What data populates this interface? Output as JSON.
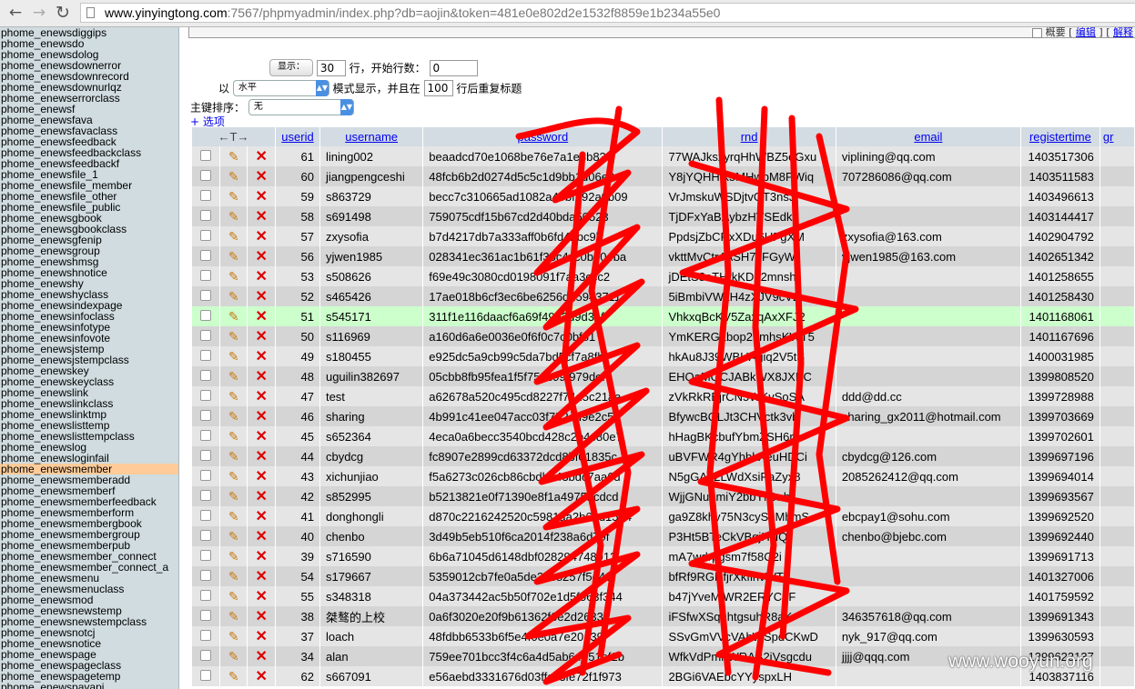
{
  "browser": {
    "url_host": "www.yinyingtong.com",
    "url_rest": ":7567/phpmyadmin/index.php?db=aojin&token=481e0e802d2e1532f8859e1b234a55e0",
    "back_icon": "arrow-left-icon",
    "forward_icon": "arrow-right-icon",
    "reload_icon": "reload-icon"
  },
  "sidebar": {
    "items": [
      "phome_enewsdiggips",
      "phome_enewsdo",
      "phome_enewsdolog",
      "phome_enewsdownerror",
      "phome_enewsdownrecord",
      "phome_enewsdownurlqz",
      "phome_enewserrorclass",
      "phome_enewsf",
      "phome_enewsfava",
      "phome_enewsfavaclass",
      "phome_enewsfeedback",
      "phome_enewsfeedbackclass",
      "phome_enewsfeedbackf",
      "phome_enewsfile_1",
      "phome_enewsfile_member",
      "phome_enewsfile_other",
      "phome_enewsfile_public",
      "phome_enewsgbook",
      "phome_enewsgbookclass",
      "phome_enewsgfenip",
      "phome_enewsgroup",
      "phome_enewshmsg",
      "phome_enewshnotice",
      "phome_enewshy",
      "phome_enewshyclass",
      "phome_enewsindexpage",
      "phome_enewsinfoclass",
      "phome_enewsinfotype",
      "phome_enewsinfovote",
      "phome_enewsjstemp",
      "phome_enewsjstempclass",
      "phome_enewskey",
      "phome_enewskeyclass",
      "phome_enewslink",
      "phome_enewslinkclass",
      "phome_enewslinktmp",
      "phome_enewslisttemp",
      "phome_enewslisttempclass",
      "phome_enewslog",
      "phome_enewsloginfail",
      "phome_enewsmember",
      "phome_enewsmemberadd",
      "phome_enewsmemberf",
      "phome_enewsmemberfeedback",
      "phome_enewsmemberform",
      "phome_enewsmembergbook",
      "phome_enewsmembergroup",
      "phome_enewsmemberpub",
      "phome_enewsmember_connect",
      "phome_enewsmember_connect_a",
      "phome_enewsmenu",
      "phome_enewsmenuclass",
      "phome_enewsmod",
      "phome_enewsnewstemp",
      "phome_enewsnewstempclass",
      "phome_enewsnotcj",
      "phome_enewsnotice",
      "phome_enewspage",
      "phome_enewspageclass",
      "phome_enewspagetemp",
      "phome_enewspayapi"
    ],
    "active_index": 40
  },
  "toplinks": {
    "summary_label": "概要",
    "edit_label": "编辑",
    "explain_label": "解释"
  },
  "controls": {
    "show_button": "显示：",
    "rows_value": "30",
    "rows_label": "行，开始行数：",
    "start_value": "0",
    "mode_prefix": "以",
    "mode_value": "水平",
    "mode_label": "模式显示，并且在",
    "repeat_value": "100",
    "repeat_label": "行后重复标题",
    "sort_label": "主键排序：",
    "sort_value": "无",
    "options_link": "+ 选项"
  },
  "table": {
    "columns": [
      "userid",
      "username",
      "password",
      "rnd",
      "email",
      "registertime",
      "gr"
    ],
    "rows": [
      [
        "61",
        "lining002",
        "beaadcd70e1068be76e7a1e3b83",
        "77WAJksxyrqHhWBZ5eGxu",
        "viplining@qq.com",
        "1403517306"
      ],
      [
        "60",
        "jiangpengceshi",
        "48fcb6b2d0274d5c5c1d9bb1d06e0",
        "Y8jYQHHfk5MHwbM8PWiq",
        "707286086@qq.com",
        "1403511583"
      ],
      [
        "59",
        "s863729",
        "becc7c310665ad1082a45bf192a0b09",
        "VrJmskuWSDjtvGT3nsJ",
        "",
        "1403496613"
      ],
      [
        "58",
        "s691498",
        "759075cdf15b67cd2d40bda50523",
        "TjDFxYaBAybzHVSEdk",
        "",
        "1403144417"
      ],
      [
        "57",
        "zxysofia",
        "b7d4217db7a333aff0b6fd42bc9b",
        "PpdsjZbCRxXDu6UFgXM",
        "zxysofia@163.com",
        "1402904792"
      ],
      [
        "56",
        "yjwen1985",
        "028341ec361ac1b61f35c4cc0b504ba",
        "vkttMvCtr4ASH7JFGyW",
        "yjwen1985@163.com",
        "1402651342"
      ],
      [
        "53",
        "s508626",
        "f69e49c3080cd0198091f7aa3ccc2",
        "jDEtS3eTHrkKDL2mnsh",
        "",
        "1401258655"
      ],
      [
        "52",
        "s465426",
        "17ae018b6cf3ec6be6256d15943711",
        "5iBmbiVWkH4zXJV9cV2",
        "",
        "1401258430"
      ],
      [
        "51",
        "s545171",
        "311f1e116daacf6a69f49a3d9d31f",
        "VhkxqBcKV5ZaxqAxXFJ2",
        "",
        "1401168061"
      ],
      [
        "50",
        "s116969",
        "a160d6a6e0036e0f6f0c7c0bf81",
        "YmKERGLbop25mhsKWT5",
        "",
        "1401167696"
      ],
      [
        "49",
        "s180455",
        "e925dc5a9cb99c5da7bd5cf7a8fb",
        "hkAu8J39WBUAgiq2V5tS",
        "",
        "1400031985"
      ],
      [
        "48",
        "uguilin382697",
        "05cbb8fb95fea1f5f75dc99f979def",
        "EHQaMGCJABkWX8JXBC",
        "",
        "1399808520"
      ],
      [
        "47",
        "test",
        "a62678a520c495cd8227f74d5c21aa",
        "zVkRkREjrCN5WKvSoSA",
        "ddd@dd.cc",
        "1399728988"
      ],
      [
        "46",
        "sharing",
        "4b991c41ee047acc03f752ed9e2c56",
        "BfywcBQLJt3CHVctk3vb",
        "sharing_gx2011@hotmail.com",
        "1399703669"
      ],
      [
        "45",
        "s652364",
        "4eca0a6becc3540bcd428c2b4c80e7",
        "hHagBKcbufYbmZSH6r",
        "",
        "1399702601"
      ],
      [
        "44",
        "cbydcg",
        "fc8907e2899cd63372dcd8bf01835c",
        "uBVFWR4gYhbkXeuHDCi",
        "cbydcg@126.com",
        "1399697196"
      ],
      [
        "43",
        "xichunjiao",
        "f5a6273c026cb86cbdb643bdc7aa6d",
        "N5gGA22LWdXsiPaZyx8",
        "2085262412@qq.com",
        "1399694014"
      ],
      [
        "42",
        "s852995",
        "b5213821e0f71390e8f1a4975bcdcd",
        "WjjGNupmiY2bbYrGnb",
        "",
        "1399693567"
      ],
      [
        "41",
        "donghongli",
        "d870c2216242520c5981aa2b6ad1564",
        "ga9Z8khv75N3cySuMhmS",
        "ebcpay1@sohu.com",
        "1399692520"
      ],
      [
        "40",
        "chenbo",
        "3d49b5eb510f6ca2014f238a6d79f",
        "P3Ht5BTeCkVBgjHNQ",
        "chenbo@bjebc.com",
        "1399692440"
      ],
      [
        "39",
        "s716590",
        "6b6a71045d6148dbf028294748912",
        "mA7wdrpgsm7f58C2i",
        "",
        "1399691713"
      ],
      [
        "54",
        "s179667",
        "5359012cb7fe0a5de24c8257f5e42",
        "bfRf9RGNfjrXkfihvWT5",
        "",
        "1401327006"
      ],
      [
        "55",
        "s348318",
        "04a373442ac5b50f702e1d5f563f344",
        "b47jYveMjWR2ERYC2F",
        "",
        "1401759592"
      ],
      [
        "38",
        "桀骜的上校",
        "0a6f3020e20f9b61362f6e2d2633d",
        "iFSfwXSqnhtgsuhR8aK",
        "346357618@qq.com",
        "1399691343"
      ],
      [
        "37",
        "loach",
        "48fdbb6533b6f5e4f0e0a7e20139",
        "SSvGmVVcVAhWSpdCKwD",
        "nyk_917@qq.com",
        "1399630593"
      ],
      [
        "34",
        "alan",
        "759ee701bcc3f4c6a4d5ab64051ef2b",
        "WfkVdPmhWRAB2jVsgcdu",
        "jjjj@qqq.com",
        "1399623137"
      ],
      [
        "62",
        "s667091",
        "e56aebd3331676d03ffcc3fe72f1f973",
        "2BGi6VAEbcYYyspxLH",
        "",
        "1403837116"
      ]
    ],
    "marked_row": 8
  },
  "colors": {
    "sidebar_bg": "#d0dce0",
    "header_bg": "#d3dce3",
    "row_light": "#e5e5e5",
    "row_dark": "#d5d5d5",
    "marked_row": "#ccffcc",
    "active_item": "#ffcc99",
    "scribble": "#ff0000"
  },
  "watermark": "www.wooyun.org"
}
